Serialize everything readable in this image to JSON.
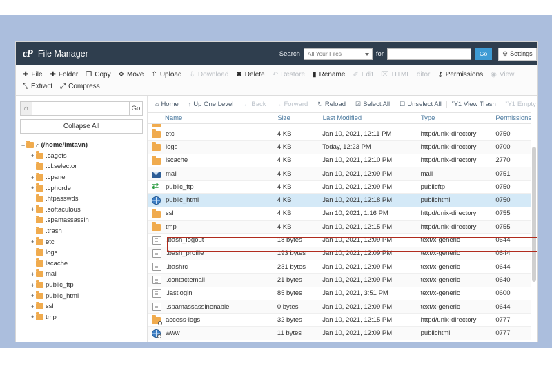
{
  "theme": {
    "header_bg": "#2f3e4e",
    "accent": "#3e9bd4",
    "page_bg": "#abbedd",
    "folder": "#f0ab4e",
    "selected_row": "#d4e9f7",
    "annotation": "#b02b1d"
  },
  "header": {
    "logo": "cP",
    "title": "File Manager",
    "search_label": "Search",
    "search_scope": "All Your Files",
    "for_label": "for",
    "search_value": "",
    "search_placeholder": "",
    "go_label": "Go",
    "settings_label": "Settings"
  },
  "toolbar": [
    {
      "icon": "plus-icon",
      "glyph": "✚",
      "label": "File",
      "disabled": false
    },
    {
      "icon": "plus-icon",
      "glyph": "✚",
      "label": "Folder",
      "disabled": false
    },
    {
      "icon": "copy-icon",
      "glyph": "❐",
      "label": "Copy",
      "disabled": false
    },
    {
      "icon": "move-icon",
      "glyph": "✥",
      "label": "Move",
      "disabled": false
    },
    {
      "icon": "upload-icon",
      "glyph": "⇧",
      "label": "Upload",
      "disabled": false
    },
    {
      "icon": "download-icon",
      "glyph": "⇩",
      "label": "Download",
      "disabled": true
    },
    {
      "icon": "close-icon",
      "glyph": "✖",
      "label": "Delete",
      "disabled": false
    },
    {
      "icon": "restore-icon",
      "glyph": "↶",
      "label": "Restore",
      "disabled": true
    },
    {
      "icon": "rename-icon",
      "glyph": "▮",
      "label": "Rename",
      "disabled": false
    },
    {
      "icon": "pencil-icon",
      "glyph": "✐",
      "label": "Edit",
      "disabled": true
    },
    {
      "icon": "html-editor-icon",
      "glyph": "⌧",
      "label": "HTML Editor",
      "disabled": true
    },
    {
      "icon": "key-icon",
      "glyph": "⚷",
      "label": "Permissions",
      "disabled": false
    },
    {
      "icon": "eye-icon",
      "glyph": "◉",
      "label": "View",
      "disabled": true
    },
    {
      "icon": "extract-icon",
      "glyph": "⤡",
      "label": "Extract",
      "disabled": false
    },
    {
      "icon": "compress-icon",
      "glyph": "⤢",
      "label": "Compress",
      "disabled": false
    }
  ],
  "sidebar": {
    "home_icon": "home-icon",
    "path_value": "",
    "path_placeholder": "",
    "go_label": "Go",
    "collapse_all_label": "Collapse All",
    "tree": [
      {
        "label": "(/home/imtavn)",
        "toggle": "−",
        "depth": 0,
        "root": true
      },
      {
        "label": ".cagefs",
        "toggle": "+",
        "depth": 1,
        "root": false
      },
      {
        "label": ".cl.selector",
        "toggle": "",
        "depth": 1,
        "root": false
      },
      {
        "label": ".cpanel",
        "toggle": "+",
        "depth": 1,
        "root": false
      },
      {
        "label": ".cphorde",
        "toggle": "+",
        "depth": 1,
        "root": false
      },
      {
        "label": ".htpasswds",
        "toggle": "",
        "depth": 1,
        "root": false
      },
      {
        "label": ".softaculous",
        "toggle": "+",
        "depth": 1,
        "root": false
      },
      {
        "label": ".spamassassin",
        "toggle": "",
        "depth": 1,
        "root": false
      },
      {
        "label": ".trash",
        "toggle": "",
        "depth": 1,
        "root": false
      },
      {
        "label": "etc",
        "toggle": "+",
        "depth": 1,
        "root": false
      },
      {
        "label": "logs",
        "toggle": "",
        "depth": 1,
        "root": false
      },
      {
        "label": "lscache",
        "toggle": "",
        "depth": 1,
        "root": false
      },
      {
        "label": "mail",
        "toggle": "+",
        "depth": 1,
        "root": false
      },
      {
        "label": "public_ftp",
        "toggle": "+",
        "depth": 1,
        "root": false
      },
      {
        "label": "public_html",
        "toggle": "+",
        "depth": 1,
        "root": false
      },
      {
        "label": "ssl",
        "toggle": "+",
        "depth": 1,
        "root": false
      },
      {
        "label": "tmp",
        "toggle": "+",
        "depth": 1,
        "root": false
      }
    ]
  },
  "navbar": [
    {
      "icon": "home-icon",
      "glyph": "⌂",
      "label": "Home",
      "disabled": false
    },
    {
      "icon": "up-level-icon",
      "glyph": "↑",
      "label": "Up One Level",
      "disabled": false
    },
    {
      "icon": "back-arrow-icon",
      "glyph": "←",
      "label": "Back",
      "disabled": true
    },
    {
      "icon": "forward-arrow-icon",
      "glyph": "→",
      "label": "Forward",
      "disabled": true
    },
    {
      "icon": "reload-icon",
      "glyph": "↻",
      "label": "Reload",
      "disabled": false
    },
    {
      "icon": "checkbox-checked-icon",
      "glyph": "☑",
      "label": "Select All",
      "disabled": false
    },
    {
      "icon": "checkbox-empty-icon",
      "glyph": "☐",
      "label": "Unselect All",
      "disabled": false
    },
    {
      "icon": "trash-icon",
      "glyph": "Ὕ1",
      "label": "View Trash",
      "disabled": false
    },
    {
      "icon": "trash-icon",
      "glyph": "Ὕ1",
      "label": "Empty Trash",
      "disabled": true
    }
  ],
  "table": {
    "columns": [
      "Name",
      "Size",
      "Last Modified",
      "Type",
      "Permissions"
    ],
    "rows": [
      {
        "icon": "folder-icon",
        "name": "etc",
        "size": "4 KB",
        "modified": "Jan 10, 2021, 12:11 PM",
        "type": "httpd/unix-directory",
        "permissions": "0750",
        "selected": false
      },
      {
        "icon": "folder-icon",
        "name": "logs",
        "size": "4 KB",
        "modified": "Today, 12:23 PM",
        "type": "httpd/unix-directory",
        "permissions": "0700",
        "selected": false
      },
      {
        "icon": "folder-icon",
        "name": "lscache",
        "size": "4 KB",
        "modified": "Jan 10, 2021, 12:10 PM",
        "type": "httpd/unix-directory",
        "permissions": "2770",
        "selected": false
      },
      {
        "icon": "mail-icon",
        "name": "mail",
        "size": "4 KB",
        "modified": "Jan 10, 2021, 12:09 PM",
        "type": "mail",
        "permissions": "0751",
        "selected": false
      },
      {
        "icon": "ftp-icon",
        "name": "public_ftp",
        "size": "4 KB",
        "modified": "Jan 10, 2021, 12:09 PM",
        "type": "publicftp",
        "permissions": "0750",
        "selected": false
      },
      {
        "icon": "globe-icon",
        "name": "public_html",
        "size": "4 KB",
        "modified": "Jan 10, 2021, 12:18 PM",
        "type": "publichtml",
        "permissions": "0750",
        "selected": true
      },
      {
        "icon": "folder-icon",
        "name": "ssl",
        "size": "4 KB",
        "modified": "Jan 10, 2021, 1:16 PM",
        "type": "httpd/unix-directory",
        "permissions": "0755",
        "selected": false
      },
      {
        "icon": "folder-icon",
        "name": "tmp",
        "size": "4 KB",
        "modified": "Jan 10, 2021, 12:15 PM",
        "type": "httpd/unix-directory",
        "permissions": "0755",
        "selected": false
      },
      {
        "icon": "file-icon",
        "name": ".bash_logout",
        "size": "18 bytes",
        "modified": "Jan 10, 2021, 12:09 PM",
        "type": "text/x-generic",
        "permissions": "0644",
        "selected": false
      },
      {
        "icon": "file-icon",
        "name": ".bash_profile",
        "size": "193 bytes",
        "modified": "Jan 10, 2021, 12:09 PM",
        "type": "text/x-generic",
        "permissions": "0644",
        "selected": false
      },
      {
        "icon": "file-icon",
        "name": ".bashrc",
        "size": "231 bytes",
        "modified": "Jan 10, 2021, 12:09 PM",
        "type": "text/x-generic",
        "permissions": "0644",
        "selected": false
      },
      {
        "icon": "file-icon",
        "name": ".contactemail",
        "size": "21 bytes",
        "modified": "Jan 10, 2021, 12:09 PM",
        "type": "text/x-generic",
        "permissions": "0640",
        "selected": false
      },
      {
        "icon": "file-icon",
        "name": ".lastlogin",
        "size": "85 bytes",
        "modified": "Jan 10, 2021, 3:51 PM",
        "type": "text/x-generic",
        "permissions": "0600",
        "selected": false
      },
      {
        "icon": "file-icon",
        "name": ".spamassassinenable",
        "size": "0 bytes",
        "modified": "Jan 10, 2021, 12:09 PM",
        "type": "text/x-generic",
        "permissions": "0644",
        "selected": false
      },
      {
        "icon": "folder-link-icon",
        "name": "access-logs",
        "size": "32 bytes",
        "modified": "Jan 10, 2021, 12:15 PM",
        "type": "httpd/unix-directory",
        "permissions": "0777",
        "selected": false
      },
      {
        "icon": "globe-link-icon",
        "name": "www",
        "size": "11 bytes",
        "modified": "Jan 10, 2021, 12:09 PM",
        "type": "publichtml",
        "permissions": "0777",
        "selected": false
      }
    ]
  },
  "annotation": {
    "target": "public_html",
    "shape": "rectangle",
    "color": "#b02b1d"
  }
}
